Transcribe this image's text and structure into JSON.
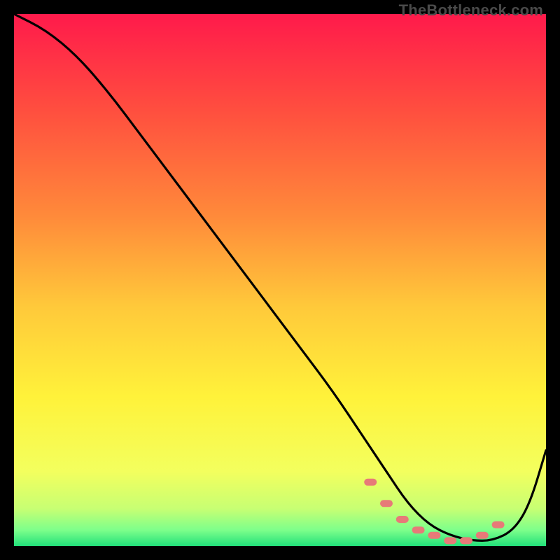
{
  "watermark": "TheBottleneck.com",
  "chart_data": {
    "type": "line",
    "title": "",
    "xlabel": "",
    "ylabel": "",
    "xlim": [
      0,
      100
    ],
    "ylim": [
      0,
      100
    ],
    "grid": false,
    "legend": "none",
    "gradient_stops": [
      {
        "pct": 0,
        "color": "#ff1a4b"
      },
      {
        "pct": 18,
        "color": "#ff4e3f"
      },
      {
        "pct": 38,
        "color": "#ff8a3a"
      },
      {
        "pct": 55,
        "color": "#ffc93a"
      },
      {
        "pct": 72,
        "color": "#fff23a"
      },
      {
        "pct": 86,
        "color": "#f3ff5e"
      },
      {
        "pct": 93,
        "color": "#c7ff73"
      },
      {
        "pct": 97,
        "color": "#7dff8b"
      },
      {
        "pct": 100,
        "color": "#22e07a"
      }
    ],
    "series": [
      {
        "name": "bottleneck-curve",
        "x": [
          0,
          6,
          12,
          18,
          24,
          30,
          36,
          42,
          48,
          54,
          60,
          66,
          70,
          74,
          78,
          82,
          86,
          90,
          94,
          97,
          100
        ],
        "y": [
          100,
          97,
          92,
          85,
          77,
          69,
          61,
          53,
          45,
          37,
          29,
          20,
          14,
          8,
          4,
          2,
          1,
          1,
          3,
          8,
          18
        ]
      }
    ],
    "markers": {
      "name": "highlight-points",
      "color": "#e77a78",
      "x": [
        67,
        70,
        73,
        76,
        79,
        82,
        85,
        88,
        91
      ],
      "y": [
        12,
        8,
        5,
        3,
        2,
        1,
        1,
        2,
        4
      ]
    }
  }
}
